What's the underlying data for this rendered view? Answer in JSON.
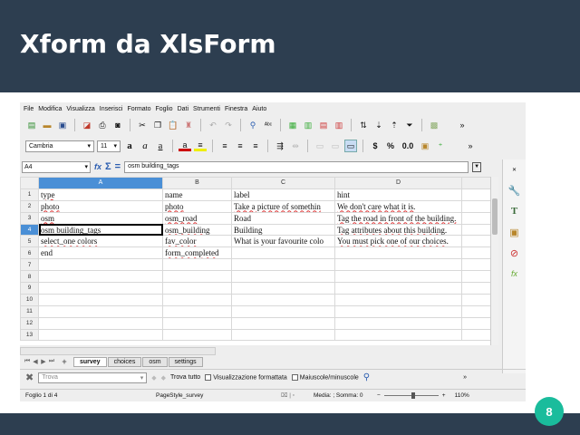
{
  "slide": {
    "title": "Xform da XlsForm",
    "page_number": "8"
  },
  "menu": [
    "File",
    "Modifica",
    "Visualizza",
    "Inserisci",
    "Formato",
    "Foglio",
    "Dati",
    "Strumenti",
    "Finestra",
    "Aiuto"
  ],
  "format_toolbar": {
    "font_name": "Cambria",
    "font_size": "11",
    "currency_symbol": "$",
    "percent_symbol": "%",
    "decimal_format": "0.0"
  },
  "formula_bar": {
    "cell_ref": "A4",
    "content": "osm building_tags"
  },
  "sheet": {
    "columns": [
      "A",
      "B",
      "C",
      "D"
    ],
    "active_column": "A",
    "active_row": 4,
    "rows": [
      {
        "num": "1",
        "cells": [
          "type",
          "name",
          "label",
          "hint"
        ]
      },
      {
        "num": "2",
        "cells": [
          "photo",
          "photo",
          "Take a picture of somethin",
          "We don't care what it is."
        ]
      },
      {
        "num": "3",
        "cells": [
          "osm",
          "osm_road",
          "Road",
          "Tag the road in front of the building."
        ]
      },
      {
        "num": "4",
        "cells": [
          "osm building_tags",
          "osm_building",
          "Building",
          "Tag attributes about this building."
        ]
      },
      {
        "num": "5",
        "cells": [
          "select_one colors",
          "fav_color",
          "What is your favourite colo",
          "You must pick one of our choices."
        ]
      },
      {
        "num": "6",
        "cells": [
          "end",
          "form_completed",
          "",
          ""
        ]
      },
      {
        "num": "7",
        "cells": [
          "",
          "",
          "",
          ""
        ]
      },
      {
        "num": "8",
        "cells": [
          "",
          "",
          "",
          ""
        ]
      },
      {
        "num": "9",
        "cells": [
          "",
          "",
          "",
          ""
        ]
      },
      {
        "num": "10",
        "cells": [
          "",
          "",
          "",
          ""
        ]
      },
      {
        "num": "11",
        "cells": [
          "",
          "",
          "",
          ""
        ]
      },
      {
        "num": "12",
        "cells": [
          "",
          "",
          "",
          ""
        ]
      },
      {
        "num": "13",
        "cells": [
          "",
          "",
          "",
          ""
        ]
      }
    ]
  },
  "sheet_tabs": [
    {
      "label": "survey",
      "active": true
    },
    {
      "label": "choices",
      "active": false
    },
    {
      "label": "osm",
      "active": false
    },
    {
      "label": "settings",
      "active": false
    }
  ],
  "find_bar": {
    "placeholder": "Trova",
    "find_all": "Trova tutto",
    "formatted_display": "Visualizzazione formattata",
    "match_case": "Maiuscole/minuscole"
  },
  "status_bar": {
    "sheet_info": "Foglio 1 di 4",
    "page_style": "PageStyle_survey",
    "summary": "Media: ; Somma: 0",
    "zoom": "110%"
  },
  "icons": [
    "new-doc-icon",
    "open-icon",
    "save-icon",
    "export-pdf-icon",
    "print-icon",
    "print-preview-icon",
    "cut-icon",
    "copy-icon",
    "paste-icon",
    "clone-format-icon",
    "undo-icon",
    "redo-icon",
    "find-replace-icon",
    "spellcheck-icon",
    "bold-icon",
    "italic-icon",
    "underline-icon",
    "font-color-icon",
    "highlight-icon",
    "align-left-icon",
    "align-center-icon",
    "align-right-icon",
    "wrap-icon",
    "merge-icon",
    "function-wizard-icon",
    "sum-icon",
    "equals-icon",
    "properties-icon",
    "styles-icon",
    "gallery-icon",
    "navigator-icon",
    "functions-icon"
  ]
}
